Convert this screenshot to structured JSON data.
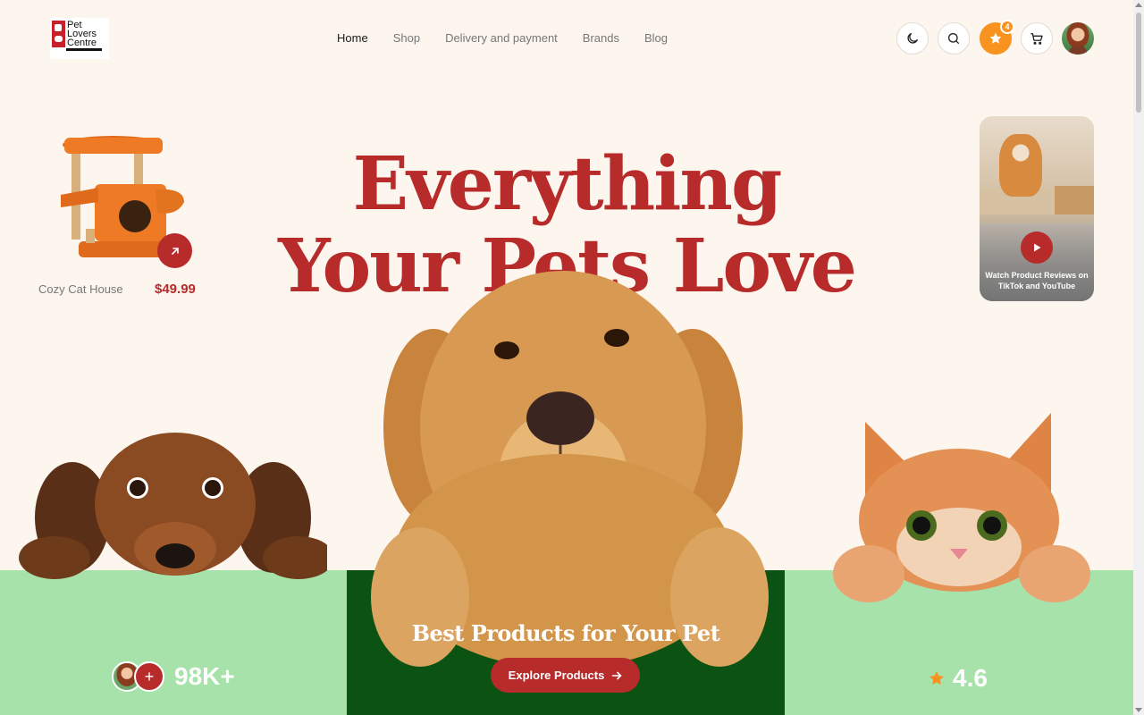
{
  "brand": {
    "line1": "Pet",
    "line2": "Lovers",
    "line3": "Centre"
  },
  "nav": {
    "items": [
      {
        "label": "Home",
        "active": true
      },
      {
        "label": "Shop"
      },
      {
        "label": "Delivery and payment"
      },
      {
        "label": "Brands"
      },
      {
        "label": "Blog"
      }
    ]
  },
  "header_actions": {
    "theme_icon": "moon-icon",
    "search_icon": "search-icon",
    "favorites_icon": "star-icon",
    "favorites_count": "4",
    "cart_icon": "cart-icon",
    "avatar": "user-avatar"
  },
  "hero": {
    "title_line1": "Everything",
    "title_line2": "Your Pets Love"
  },
  "featured_product": {
    "name": "Cozy Cat House",
    "price": "$49.99",
    "action_icon": "arrow-up-right-icon"
  },
  "video_card": {
    "text": "Watch Product Reviews on TikTok and YouTube",
    "play_icon": "play-icon"
  },
  "stats": {
    "customers": "98K+",
    "add_icon": "+",
    "rating": "4.6",
    "rating_icon": "star-icon"
  },
  "cta": {
    "title": "Best Products for Your Pet",
    "button_label": "Explore Products",
    "button_icon": "arrow-right-icon"
  },
  "colors": {
    "accent": "#b72b2b",
    "background": "#fdf6ee",
    "panel_green": "#a8e2ab",
    "panel_dark_green": "#0c5212",
    "star_orange": "#f7931e"
  }
}
